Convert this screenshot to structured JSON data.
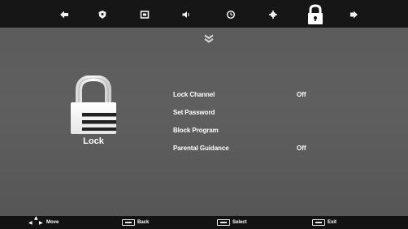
{
  "top_menu": {
    "icons": [
      {
        "name": "picture-icon"
      },
      {
        "name": "channel-icon"
      },
      {
        "name": "setup-icon"
      },
      {
        "name": "sound-icon"
      },
      {
        "name": "time-icon"
      },
      {
        "name": "option-icon"
      },
      {
        "name": "lock-icon",
        "active": true
      },
      {
        "name": "media-icon"
      }
    ]
  },
  "section": {
    "title": "Lock",
    "more_indicator": "chevron-double-down-icon"
  },
  "menu_items": [
    {
      "label": "Lock Channel",
      "value": "Off"
    },
    {
      "label": "Set Password",
      "value": ""
    },
    {
      "label": "Block Program",
      "value": ""
    },
    {
      "label": "Parental Guidance",
      "value": "Off"
    }
  ],
  "help_bar": {
    "move": "Move",
    "back": "Back",
    "select": "Select",
    "exit": "Exit"
  },
  "colors": {
    "background": "#5a5a5a",
    "bars": "#161616",
    "text": "#ffffff"
  }
}
